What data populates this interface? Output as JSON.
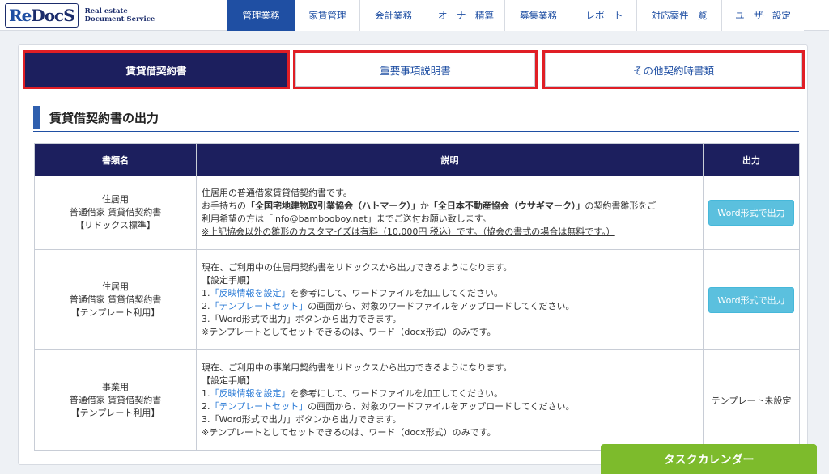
{
  "header": {
    "logo": {
      "re": "Re",
      "docs": "DocS",
      "tagline_1": "Real estate",
      "tagline_2": "Document Service"
    },
    "nav": [
      {
        "label": "管理業務",
        "active": true
      },
      {
        "label": "家賃管理",
        "active": false
      },
      {
        "label": "会計業務",
        "active": false
      },
      {
        "label": "オーナー精算",
        "active": false
      },
      {
        "label": "募集業務",
        "active": false
      },
      {
        "label": "レポート",
        "active": false
      },
      {
        "label": "対応案件一覧",
        "active": false
      },
      {
        "label": "ユーザー設定",
        "active": false
      }
    ]
  },
  "tabs": [
    {
      "label": "賃貸借契約書",
      "active": true
    },
    {
      "label": "重要事項説明書",
      "active": false
    },
    {
      "label": "その他契約時書類",
      "active": false
    }
  ],
  "section_title": "賃貸借契約書の出力",
  "table": {
    "headers": {
      "name": "書類名",
      "desc": "説明",
      "output": "出力"
    },
    "rows": [
      {
        "name": [
          "住居用",
          "普通借家 賃貸借契約書",
          "【リドックス標準】"
        ],
        "desc": {
          "line1": "住居用の普通借家賃貸借契約書です。",
          "line2a": "お手持ちの",
          "line2b": "「全国宅地建物取引業協会（ハトマーク）」",
          "line2c": "か",
          "line2d": "「全日本不動産協会（ウサギマーク）」",
          "line2e": "の契約書雛形をご",
          "line3": "利用希望の方は「info@bambooboy.net」までご送付お願い致します。",
          "line4": "※上記協会以外の雛形のカスタマイズは有料（10,000円 税込）です。（協会の書式の場合は無料です。）"
        },
        "output": "Word形式で出力"
      },
      {
        "name": [
          "住居用",
          "普通借家 賃貸借契約書",
          "【テンプレート利用】"
        ],
        "desc": {
          "line1": "現在、ご利用中の住居用契約書をリドックスから出力できるようになります。",
          "line2": "【設定手順】",
          "s1_num": "1.",
          "s1_link": "「反映情報を設定」",
          "s1_rest": "を参考にして、ワードファイルを加工してください。",
          "s2_num": "2.",
          "s2_link": "「テンプレートセット」",
          "s2_rest": "の画面から、対象のワードファイルをアップロードしてください。",
          "s3": "3.「Word形式で出力」ボタンから出力できます。",
          "note": "※テンプレートとしてセットできるのは、ワード（docx形式）のみです。"
        },
        "output": "Word形式で出力"
      },
      {
        "name": [
          "事業用",
          "普通借家 賃貸借契約書",
          "【テンプレート利用】"
        ],
        "desc": {
          "line1": "現在、ご利用中の事業用契約書をリドックスから出力できるようになります。",
          "line2": "【設定手順】",
          "s1_num": "1.",
          "s1_link": "「反映情報を設定」",
          "s1_rest": "を参考にして、ワードファイルを加工してください。",
          "s2_num": "2.",
          "s2_link": "「テンプレートセット」",
          "s2_rest": "の画面から、対象のワードファイルをアップロードしてください。",
          "s3": "3.「Word形式で出力」ボタンから出力できます。",
          "note": "※テンプレートとしてセットできるのは、ワード（docx形式）のみです。"
        },
        "output": "テンプレート未設定"
      }
    ]
  },
  "task_calendar": "タスクカレンダー",
  "colors": {
    "navy": "#1c1f5e",
    "primary": "#1f4fa3",
    "highlight": "#e01e25",
    "button": "#5bc0de",
    "green": "#7dbb2c"
  }
}
